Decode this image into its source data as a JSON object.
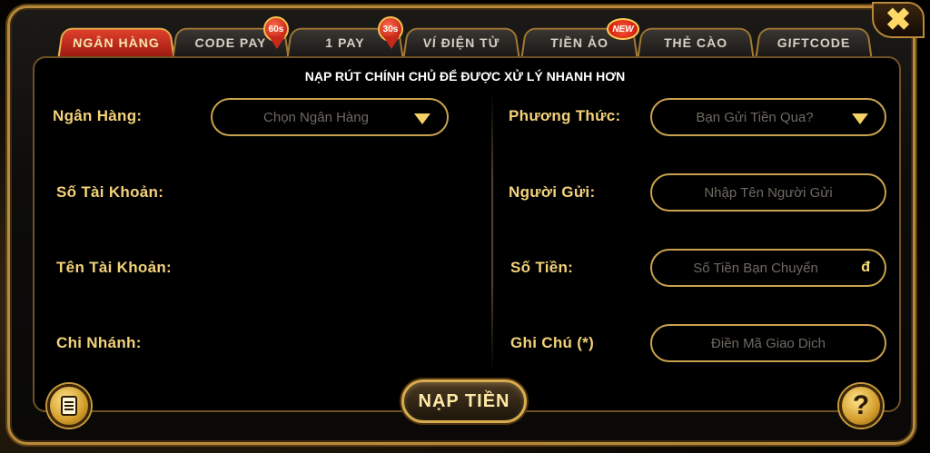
{
  "tabs": [
    {
      "label": "NGÂN HÀNG",
      "active": true
    },
    {
      "label": "CODE PAY",
      "badge": "60s"
    },
    {
      "label": "1 PAY",
      "badge": "30s"
    },
    {
      "label": "VÍ ĐIỆN TỬ"
    },
    {
      "label": "TIỀN ẢO",
      "badge": "NEW"
    },
    {
      "label": "THẺ CÀO"
    },
    {
      "label": "GIFTCODE"
    }
  ],
  "close_label": "✖",
  "headline": "NẠP RÚT CHÍNH CHỦ ĐỂ ĐƯỢC XỬ LÝ NHANH HƠN",
  "left": {
    "bank_label": "Ngân Hàng:",
    "bank_select_placeholder": "Chọn Ngân Hàng",
    "account_number_label": "Số Tài Khoản:",
    "account_name_label": "Tên Tài Khoản:",
    "branch_label": "Chi Nhánh:"
  },
  "right": {
    "method_label": "Phương Thức:",
    "method_select_placeholder": "Bạn Gửi Tiền Qua?",
    "sender_label": "Người Gửi:",
    "sender_placeholder": "Nhập Tên Người Gửi",
    "amount_label": "Số Tiền:",
    "amount_placeholder": "Số Tiền Bạn Chuyển",
    "amount_currency": "đ",
    "note_label": "Ghi Chú (*)",
    "note_placeholder": "Điền Mã Giao Dịch"
  },
  "submit_label": "NẠP TIỀN",
  "help_label": "?",
  "colors": {
    "accent_gold": "#f3d27a",
    "active_tab": "#d2301e",
    "border_gold": "#c9a24e"
  }
}
